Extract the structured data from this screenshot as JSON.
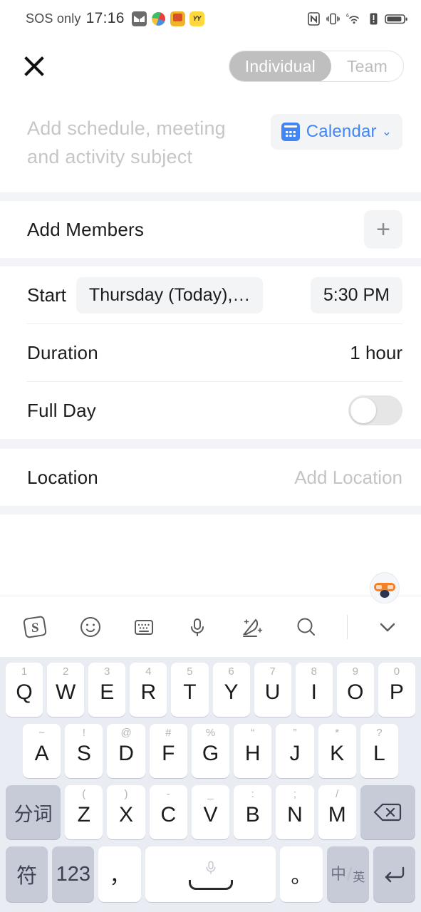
{
  "status_bar": {
    "carrier": "SOS only",
    "time": "17:16",
    "app_icons": [
      "mail-icon",
      "swirl-app-icon",
      "orange-app-icon",
      "yy-app-icon"
    ],
    "right_icons": [
      "nfc-icon",
      "vibrate-icon",
      "wifi-6-icon",
      "alert-icon",
      "battery-icon"
    ]
  },
  "topnav": {
    "close_label": "✕",
    "segments": [
      {
        "label": "Individual",
        "selected": true
      },
      {
        "label": "Team",
        "selected": false
      }
    ]
  },
  "subject": {
    "placeholder": "Add schedule, meeting and activity subject",
    "calendar_button": {
      "label": "Calendar",
      "chevron": "⌄",
      "color": "#4285f4"
    }
  },
  "members": {
    "label": "Add Members",
    "add_glyph": "+"
  },
  "schedule": {
    "start": {
      "label": "Start",
      "date_chip": "Thursday (Today),…",
      "time_chip": "5:30 PM"
    },
    "duration": {
      "label": "Duration",
      "value": "1 hour"
    },
    "full_day": {
      "label": "Full Day",
      "enabled": false
    }
  },
  "location": {
    "label": "Location",
    "value": "Add Location"
  },
  "keyboard": {
    "toolbar": [
      "sogou-logo-icon",
      "emoji-icon",
      "keyboard-icon",
      "microphone-icon",
      "handwriting-icon",
      "search-icon",
      "chevron-down-icon"
    ],
    "mascot": "fox-mascot-icon",
    "row1": [
      {
        "main": "Q",
        "hint": "1"
      },
      {
        "main": "W",
        "hint": "2"
      },
      {
        "main": "E",
        "hint": "3"
      },
      {
        "main": "R",
        "hint": "4"
      },
      {
        "main": "T",
        "hint": "5"
      },
      {
        "main": "Y",
        "hint": "6"
      },
      {
        "main": "U",
        "hint": "7"
      },
      {
        "main": "I",
        "hint": "8"
      },
      {
        "main": "O",
        "hint": "9"
      },
      {
        "main": "P",
        "hint": "0"
      }
    ],
    "row2": [
      {
        "main": "A",
        "hint": "~"
      },
      {
        "main": "S",
        "hint": "!"
      },
      {
        "main": "D",
        "hint": "@"
      },
      {
        "main": "F",
        "hint": "#"
      },
      {
        "main": "G",
        "hint": "%"
      },
      {
        "main": "H",
        "hint": "“"
      },
      {
        "main": "J",
        "hint": "”"
      },
      {
        "main": "K",
        "hint": "*"
      },
      {
        "main": "L",
        "hint": "?"
      }
    ],
    "row3": [
      {
        "main": "分词",
        "hint": "",
        "fn": true
      },
      {
        "main": "Z",
        "hint": "("
      },
      {
        "main": "X",
        "hint": ")"
      },
      {
        "main": "C",
        "hint": "-"
      },
      {
        "main": "V",
        "hint": "_"
      },
      {
        "main": "B",
        "hint": ":"
      },
      {
        "main": "N",
        "hint": ";"
      },
      {
        "main": "M",
        "hint": "/"
      },
      {
        "main": "⌫",
        "hint": "",
        "fn": true
      }
    ],
    "row4": {
      "symbol": "符",
      "numeric": "123",
      "comma": "，",
      "space": "space-bar",
      "period": "。",
      "lang_zh": "中",
      "lang_en": "英",
      "enter": "↵"
    }
  }
}
